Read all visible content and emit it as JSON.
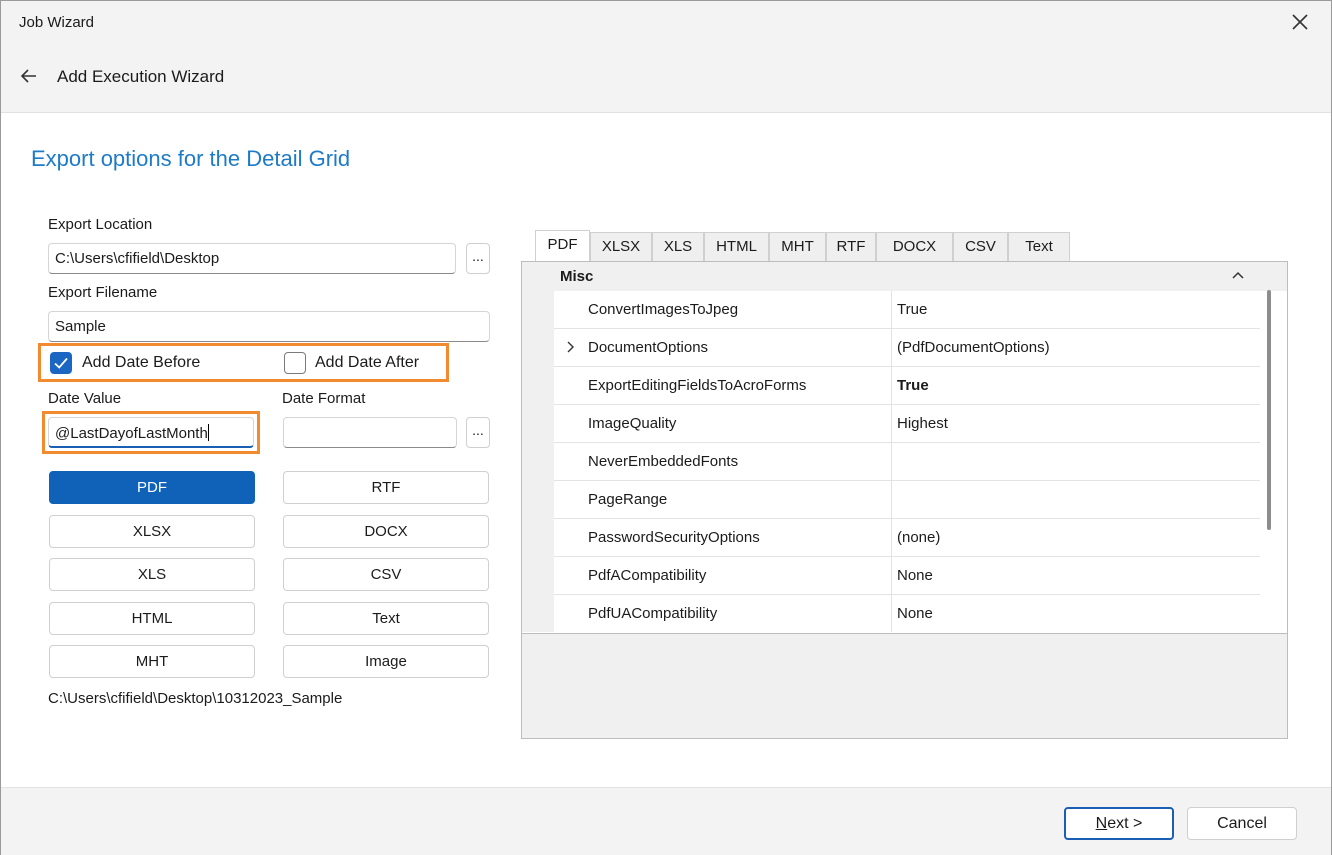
{
  "window": {
    "title": "Job Wizard"
  },
  "wizard": {
    "title": "Add Execution Wizard"
  },
  "page": {
    "heading": "Export options for the Detail Grid"
  },
  "form": {
    "export_location_label": "Export Location",
    "export_location_value": "C:\\Users\\cfifield\\Desktop",
    "browse_label": "...",
    "export_filename_label": "Export Filename",
    "export_filename_value": "Sample",
    "add_date_before_label": "Add Date Before",
    "add_date_before_checked": true,
    "add_date_after_label": "Add Date After",
    "add_date_after_checked": false,
    "date_value_label": "Date Value",
    "date_value_value": "@LastDayofLastMonth",
    "date_format_label": "Date Format",
    "date_format_value": "",
    "date_format_browse_label": "...",
    "output_path": "C:\\Users\\cfifield\\Desktop\\10312023_Sample"
  },
  "format_buttons": {
    "pdf": "PDF",
    "rtf": "RTF",
    "xlsx": "XLSX",
    "docx": "DOCX",
    "xls": "XLS",
    "csv": "CSV",
    "html": "HTML",
    "text": "Text",
    "mht": "MHT",
    "image": "Image",
    "selected": "PDF"
  },
  "tabs": [
    "PDF",
    "XLSX",
    "XLS",
    "HTML",
    "MHT",
    "RTF",
    "DOCX",
    "CSV",
    "Text"
  ],
  "active_tab": "PDF",
  "property_grid": {
    "category": "Misc",
    "rows": [
      {
        "name": "ConvertImagesToJpeg",
        "value": "True"
      },
      {
        "name": "DocumentOptions",
        "value": "(PdfDocumentOptions)"
      },
      {
        "name": "ExportEditingFieldsToAcroForms",
        "value": "True"
      },
      {
        "name": "ImageQuality",
        "value": "Highest"
      },
      {
        "name": "NeverEmbeddedFonts",
        "value": ""
      },
      {
        "name": "PageRange",
        "value": ""
      },
      {
        "name": "PasswordSecurityOptions",
        "value": "(none)"
      },
      {
        "name": "PdfACompatibility",
        "value": "None"
      },
      {
        "name": "PdfUACompatibility",
        "value": "None"
      }
    ]
  },
  "footer": {
    "next_mnemonic": "N",
    "next_rest": "ext >",
    "cancel_label": "Cancel"
  },
  "colors": {
    "accent": "#1e7bc7",
    "primary_button": "#0f62b8",
    "highlight": "#f28b30"
  },
  "icons": {
    "close": "close-icon",
    "back": "back-arrow-icon",
    "checkbox": "checkmark-icon",
    "expand": "chevron-right-icon",
    "collapse": "chevron-up-icon"
  }
}
